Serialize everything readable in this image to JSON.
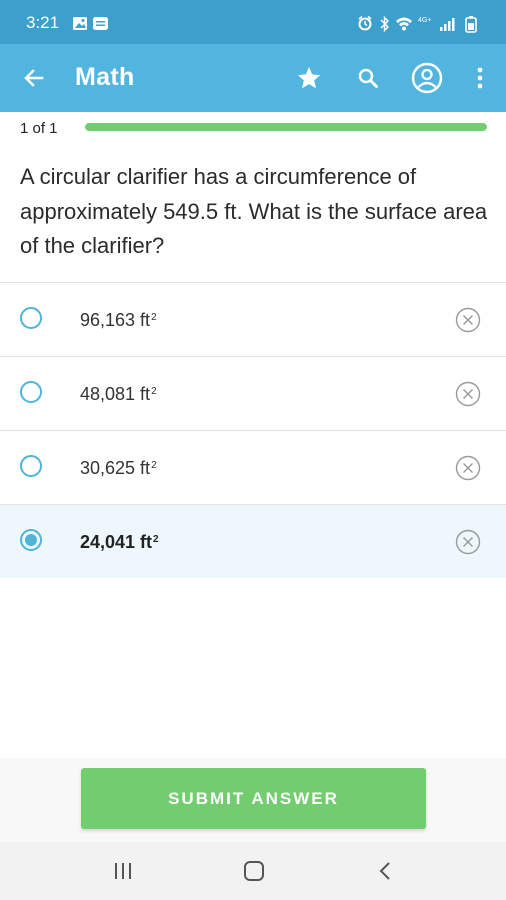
{
  "status_bar": {
    "time": "3:21",
    "left_icons": [
      "image-icon",
      "notification-icon"
    ],
    "right_icons": [
      "alarm-icon",
      "bluetooth-icon",
      "wifi-icon",
      "signal-icon",
      "battery-icon"
    ],
    "network_label": "4G+"
  },
  "app_bar": {
    "title": "Math",
    "actions": [
      "back-arrow-icon",
      "star-icon",
      "search-icon",
      "account-icon",
      "more-vertical-icon"
    ]
  },
  "progress": {
    "label": "1 of 1",
    "fraction": 1.0
  },
  "question": {
    "text": "A circular clarifier has a circumference of approximately 549.5 ft. What is the surface area of the clarifier?"
  },
  "options": [
    {
      "value": "96,163 ft",
      "superscript": "2",
      "selected": false
    },
    {
      "value": "48,081 ft",
      "superscript": "2",
      "selected": false
    },
    {
      "value": "30,625 ft",
      "superscript": "2",
      "selected": false
    },
    {
      "value": "24,041 ft",
      "superscript": "2",
      "selected": true
    }
  ],
  "submit": {
    "label": "SUBMIT ANSWER"
  },
  "nav_bar": {
    "icons": [
      "recent-apps-icon",
      "home-icon",
      "back-icon"
    ]
  },
  "colors": {
    "status_bar": "#3d9fcb",
    "app_bar": "#51b5e0",
    "accent": "#4fb4da",
    "progress": "#72cd6e",
    "submit": "#71cd6e",
    "selected_row": "#eef8fc"
  }
}
